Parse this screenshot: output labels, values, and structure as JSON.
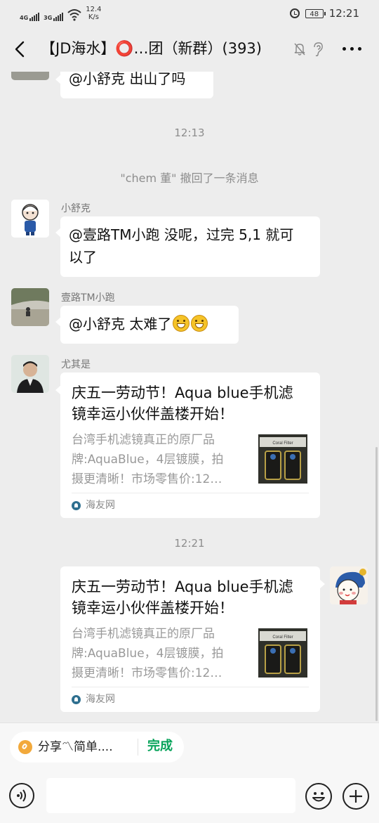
{
  "status_bar": {
    "signal1_label": "4G",
    "signal2_label": "3G",
    "speed_value": "12.4",
    "speed_unit": "K/s",
    "battery": "48",
    "time": "12:21"
  },
  "header": {
    "title": "【JD海水】⭕…团（新群）(393)"
  },
  "messages": {
    "partial_message": "@小舒克  出山了吗",
    "timestamp1": "12:13",
    "recall_notice": "\"chem 董\" 撤回了一条消息",
    "msg1_sender": "小舒克",
    "msg1_text_line1": "@壹路TM小跑  没呢，过完 5,1 就可",
    "msg1_text_line2": "以了",
    "msg2_sender": "壹路TM小跑",
    "msg2_text": "@小舒克  太难了",
    "msg3_sender": "尤其是",
    "card1": {
      "title_line1": "庆五一劳动节！Aqua blue手机滤",
      "title_line2": "镜幸运小伙伴盖楼开始！",
      "desc_line1": "台湾手机滤镜真正的原厂品",
      "desc_line2": "牌:AquaBlue，4层镀膜，拍",
      "desc_line3": "摄更清晰！市场零售价:12…",
      "thumb_label": "Coral Filter",
      "source": "海友网"
    },
    "timestamp2": "12:21",
    "card2": {
      "title_line1": "庆五一劳动节！Aqua blue手机滤",
      "title_line2": "镜幸运小伙伴盖楼开始！",
      "desc_line1": "台湾手机滤镜真正的原厂品",
      "desc_line2": "牌:AquaBlue，4层镀膜，拍",
      "desc_line3": "摄更清晰！市场零售价:12…",
      "thumb_label": "Coral Filter",
      "source": "海友网"
    }
  },
  "bottom_bar": {
    "quote_text": "分享〽简单....",
    "done_label": "完成",
    "input_value": ""
  },
  "icons": {
    "back": "chevron-left-icon",
    "mute": "bell-off-icon",
    "ear": "ear-icon",
    "more": "more-dots-icon",
    "voice": "voice-icon",
    "emoji": "emoji-icon",
    "plus": "plus-icon"
  },
  "colors": {
    "background": "#ededed",
    "bubble": "#ffffff",
    "done_green": "#07a35a",
    "meta_gray": "#8d8d8d"
  }
}
